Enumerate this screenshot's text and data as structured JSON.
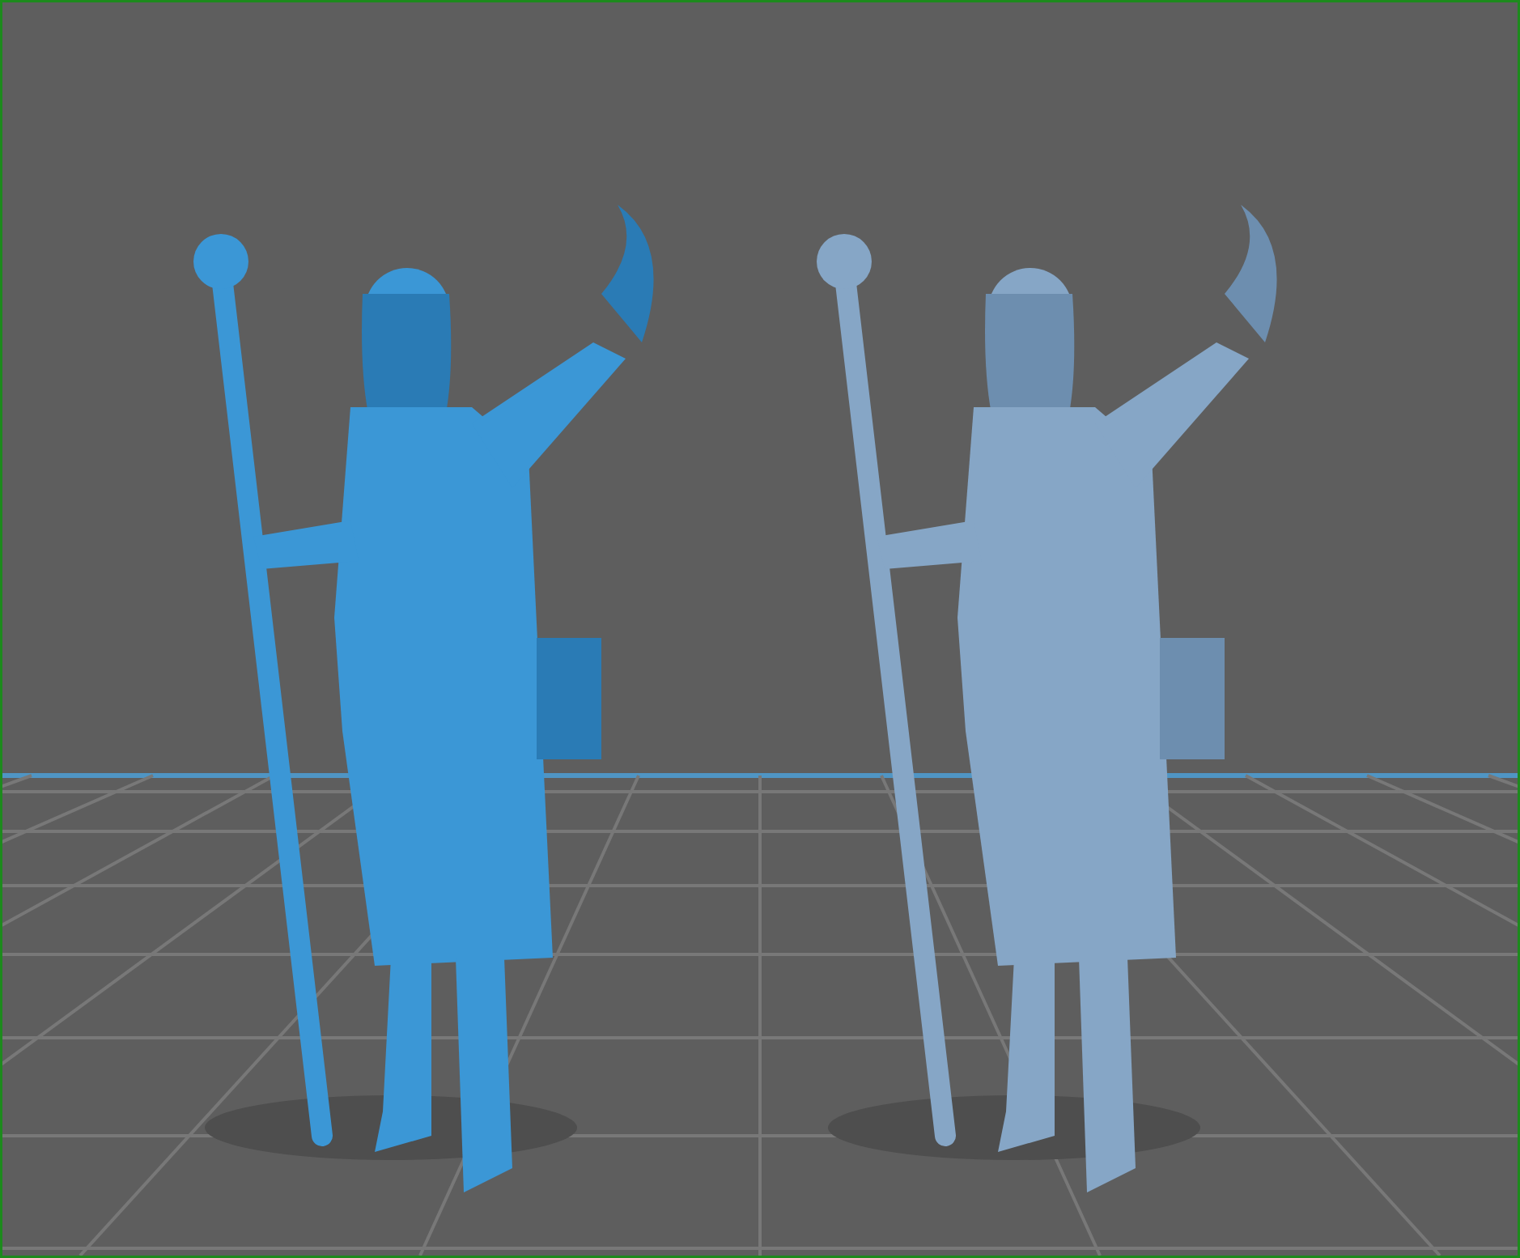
{
  "viewport": {
    "models": [
      {
        "selected": true
      },
      {
        "selected": false
      }
    ]
  }
}
